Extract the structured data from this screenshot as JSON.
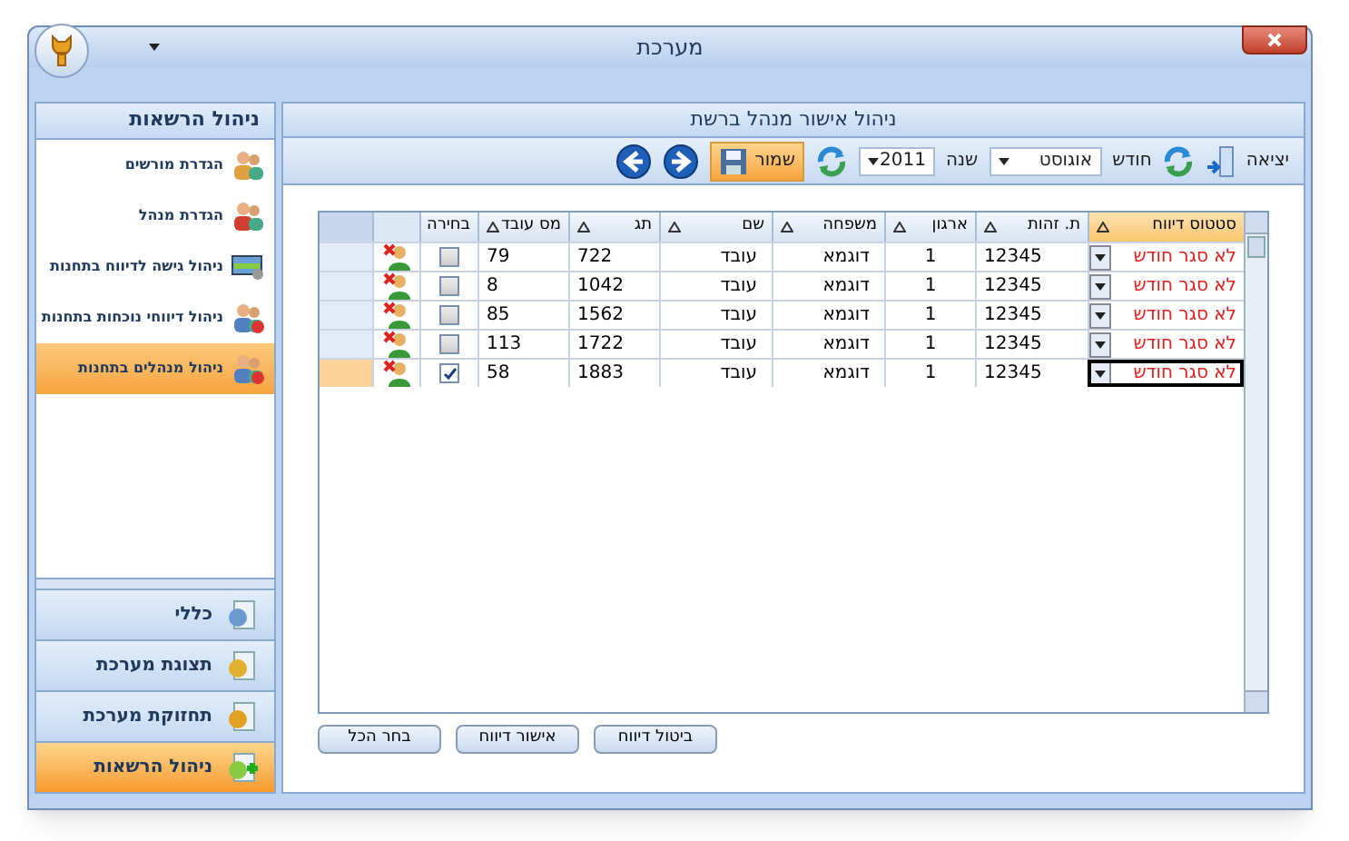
{
  "window": {
    "title": "מערכת"
  },
  "sidebar": {
    "title": "ניהול הרשאות",
    "items": [
      {
        "label": "הגדרת מורשים",
        "selected": false
      },
      {
        "label": "הגדרת מנהל",
        "selected": false
      },
      {
        "label": "ניהול גישה לדיווח בתחנות",
        "selected": false
      },
      {
        "label": "ניהול דיווחי נוכחות בתחנות",
        "selected": false
      },
      {
        "label": "ניהול מנהלים בתחנות",
        "selected": true
      }
    ],
    "sections": [
      {
        "label": "כללי",
        "selected": false
      },
      {
        "label": "תצוגת מערכת",
        "selected": false
      },
      {
        "label": "תחזוקת מערכת",
        "selected": false
      },
      {
        "label": "ניהול הרשאות",
        "selected": true
      }
    ]
  },
  "panel": {
    "title": "ניהול אישור מנהל ברשת",
    "toolbar": {
      "exit": "יציאה",
      "month_label": "חודש",
      "month": "אוגוסט",
      "year_label": "שנה",
      "year": "2011",
      "save": "שמור"
    }
  },
  "table": {
    "columns": [
      "סטטוס דיווח",
      "ת. זהות",
      "ארגון",
      "משפחה",
      "שם",
      "תג",
      "מס עובד",
      "בחירה"
    ],
    "rows": [
      {
        "status": "לא סגר חודש",
        "id": "12345",
        "org": "1",
        "family": "דוגמא",
        "name": "עובד",
        "tag": "722",
        "emp_no": "79",
        "checked": false,
        "selected": false
      },
      {
        "status": "לא סגר חודש",
        "id": "12345",
        "org": "1",
        "family": "דוגמא",
        "name": "עובד",
        "tag": "1042",
        "emp_no": "8",
        "checked": false,
        "selected": false
      },
      {
        "status": "לא סגר חודש",
        "id": "12345",
        "org": "1",
        "family": "דוגמא",
        "name": "עובד",
        "tag": "1562",
        "emp_no": "85",
        "checked": false,
        "selected": false
      },
      {
        "status": "לא סגר חודש",
        "id": "12345",
        "org": "1",
        "family": "דוגמא",
        "name": "עובד",
        "tag": "1722",
        "emp_no": "113",
        "checked": false,
        "selected": false
      },
      {
        "status": "לא סגר חודש",
        "id": "12345",
        "org": "1",
        "family": "דוגמא",
        "name": "עובד",
        "tag": "1883",
        "emp_no": "58",
        "checked": true,
        "selected": true
      }
    ]
  },
  "buttons": [
    "ביטול דיווח",
    "אישור דיווח",
    "בחר הכל"
  ]
}
